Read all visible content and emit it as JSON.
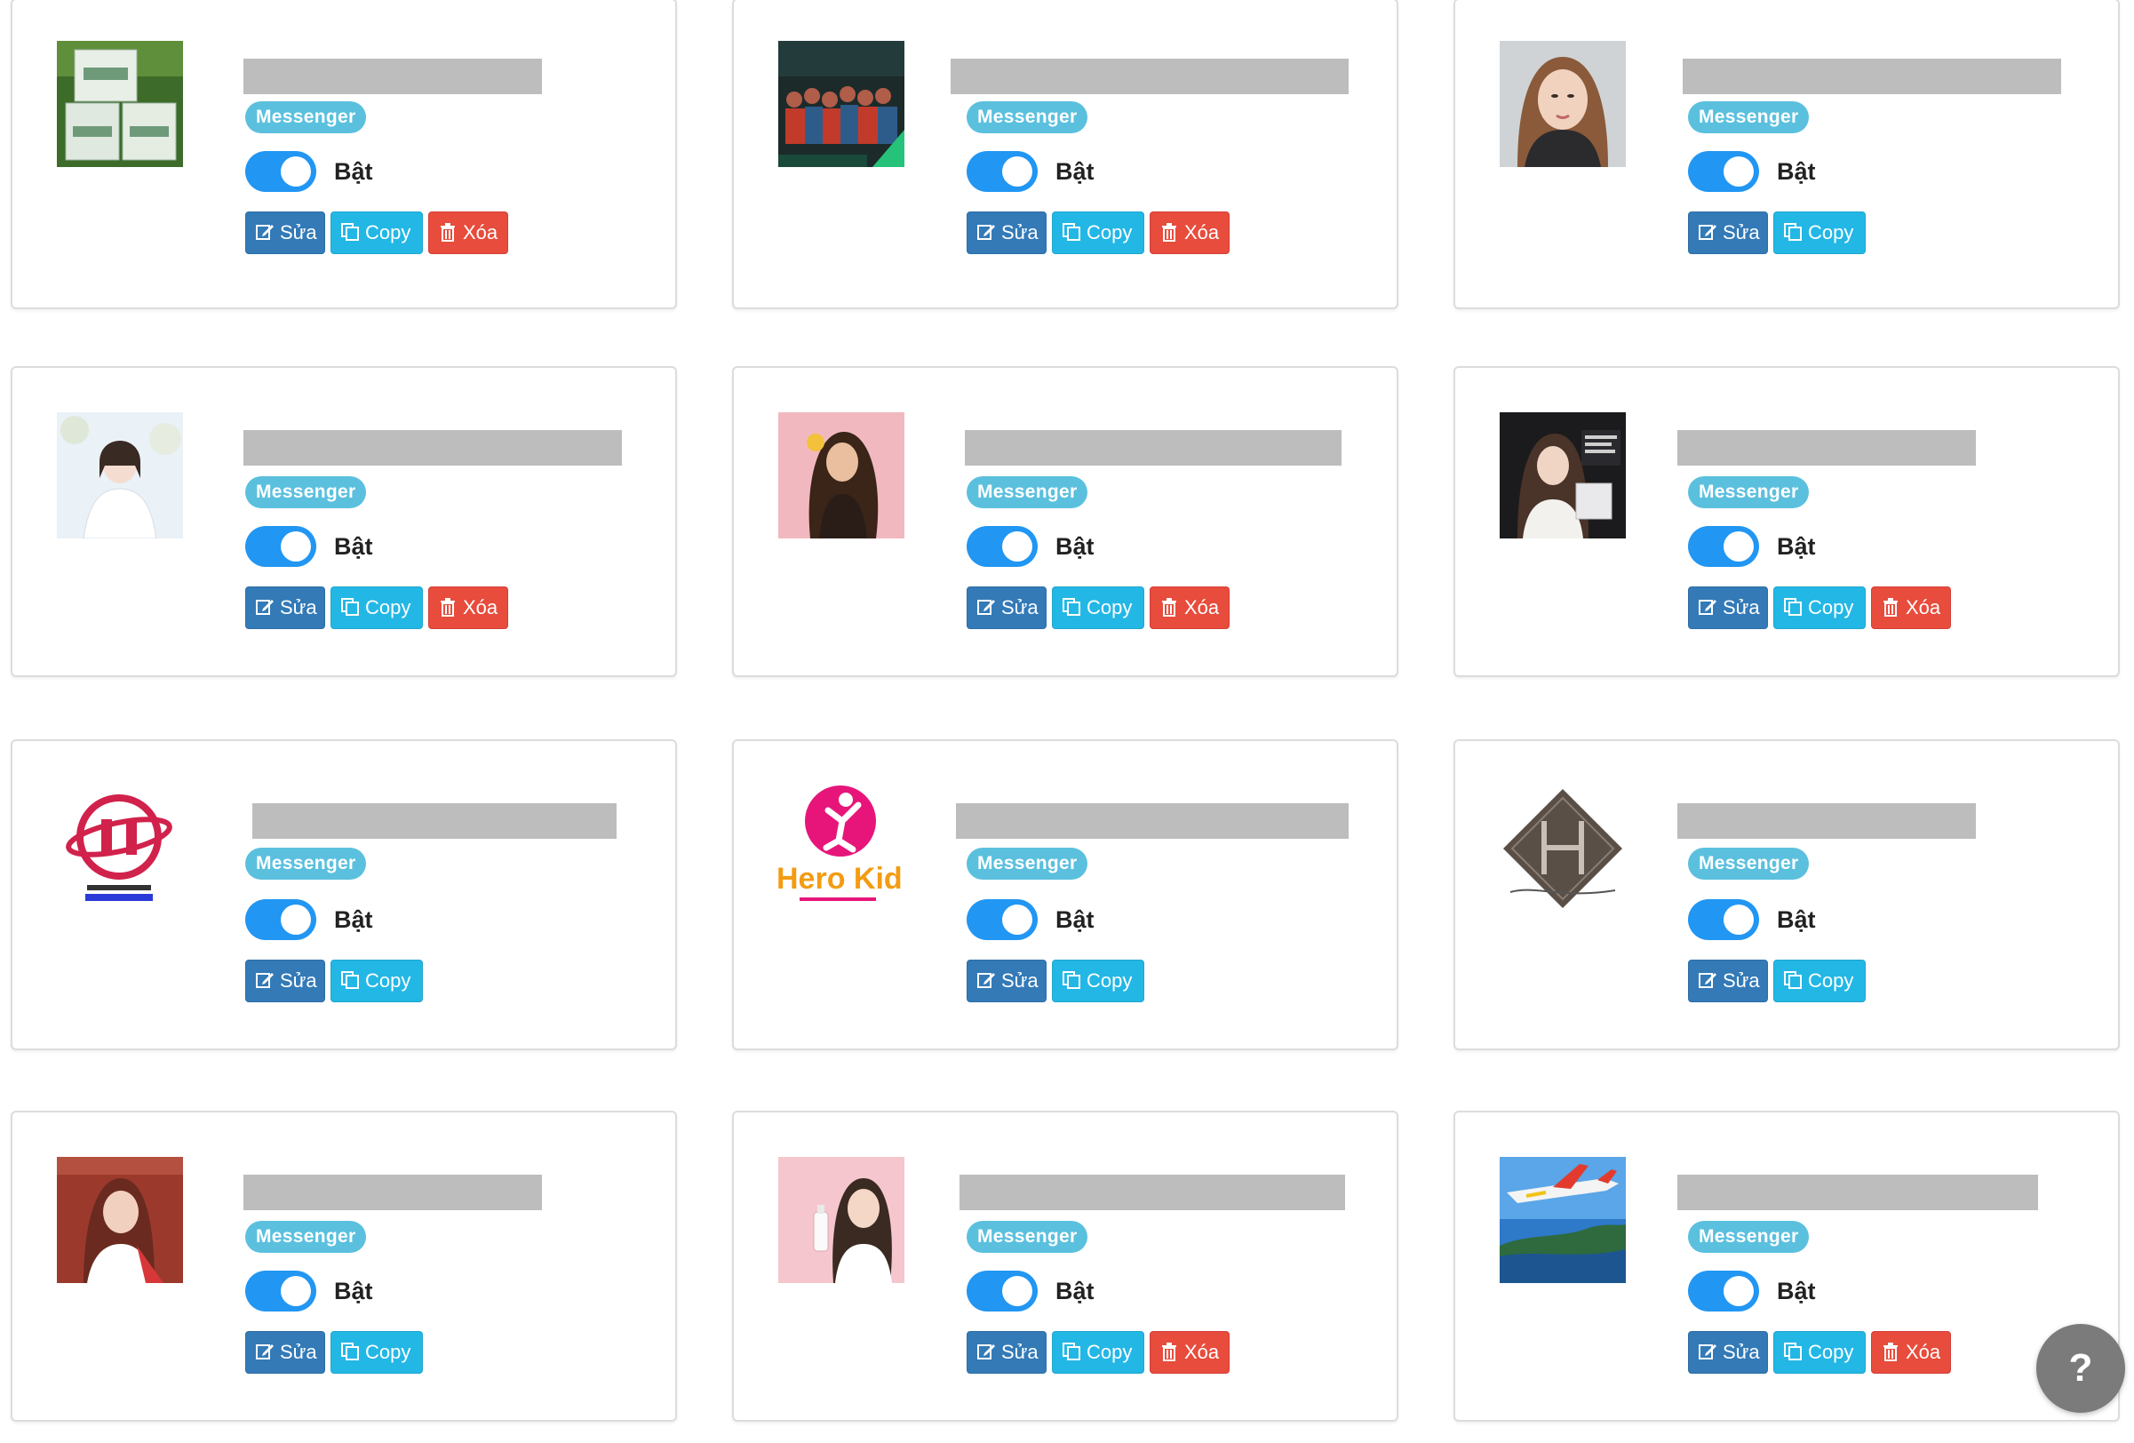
{
  "cards": [
    {
      "badge": "Messenger",
      "status": "Bật",
      "edit_label": "Sửa",
      "copy_label": "Copy",
      "delete_label": "Xóa",
      "avatar_icon": "boxes-product-photo"
    },
    {
      "badge": "Messenger",
      "status": "Bật",
      "edit_label": "Sửa",
      "copy_label": "Copy",
      "delete_label": "Xóa",
      "avatar_icon": "group-photo"
    },
    {
      "badge": "Messenger",
      "status": "Bật",
      "edit_label": "Sửa",
      "copy_label": "Copy",
      "avatar_icon": "woman-portrait"
    },
    {
      "badge": "Messenger",
      "status": "Bật",
      "edit_label": "Sửa",
      "copy_label": "Copy",
      "delete_label": "Xóa",
      "avatar_icon": "bride-portrait"
    },
    {
      "badge": "Messenger",
      "status": "Bật",
      "edit_label": "Sửa",
      "copy_label": "Copy",
      "delete_label": "Xóa",
      "avatar_icon": "woman-pink-background"
    },
    {
      "badge": "Messenger",
      "status": "Bật",
      "edit_label": "Sửa",
      "copy_label": "Copy",
      "delete_label": "Xóa",
      "avatar_icon": "woman-dark-product"
    },
    {
      "badge": "Messenger",
      "status": "Bật",
      "edit_label": "Sửa",
      "copy_label": "Copy",
      "avatar_icon": "bi-logo"
    },
    {
      "badge": "Messenger",
      "status": "Bật",
      "edit_label": "Sửa",
      "copy_label": "Copy",
      "avatar_icon": "hero-kids-logo",
      "logo_text": "Hero Kids"
    },
    {
      "badge": "Messenger",
      "status": "Bật",
      "edit_label": "Sửa",
      "copy_label": "Copy",
      "avatar_icon": "h-monogram-logo"
    },
    {
      "badge": "Messenger",
      "status": "Bật",
      "edit_label": "Sửa",
      "copy_label": "Copy",
      "avatar_icon": "woman-red-portrait"
    },
    {
      "badge": "Messenger",
      "status": "Bật",
      "edit_label": "Sửa",
      "copy_label": "Copy",
      "delete_label": "Xóa",
      "avatar_icon": "woman-pink-product"
    },
    {
      "badge": "Messenger",
      "status": "Bật",
      "edit_label": "Sửa",
      "copy_label": "Copy",
      "delete_label": "Xóa",
      "avatar_icon": "airplane-sky"
    }
  ],
  "help_label": "?",
  "colors": {
    "badge": "#5bc0de",
    "toggle_on": "#2196f3",
    "edit": "#337ab7",
    "copy": "#23b7e5",
    "delete": "#e74c3c",
    "name_placeholder": "#bdbdbd"
  }
}
